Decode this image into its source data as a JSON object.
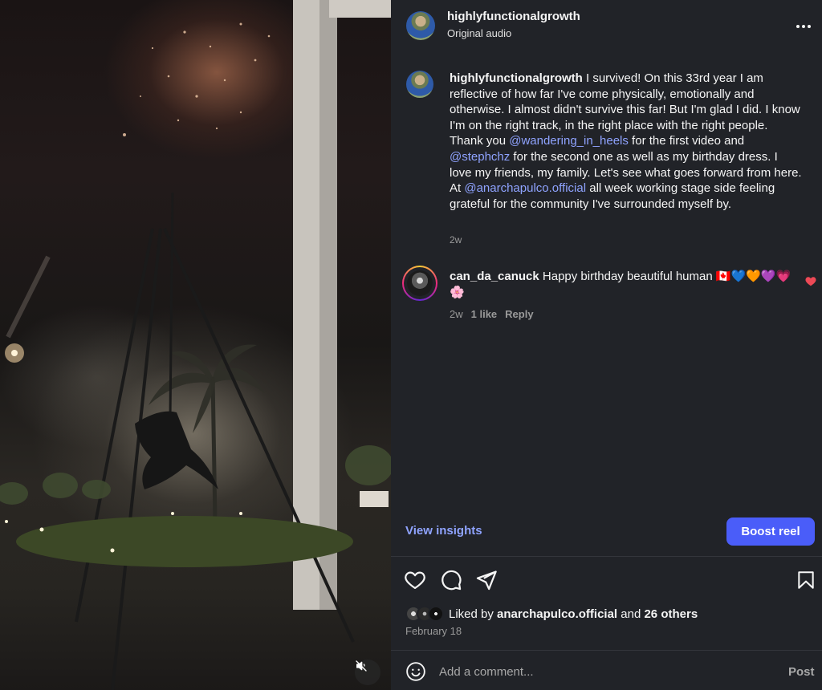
{
  "post": {
    "username": "highlyfunctionalgrowth",
    "audio": "Original audio"
  },
  "caption": {
    "username": "highlyfunctionalgrowth",
    "segments": [
      " I survived! On this 33rd year I am reflective of how far I've come physically, emotionally and otherwise. I almost didn't survive this far! But I'm glad I did. I know I'm on the right track, in the right place with the right people. Thank you ",
      "@wandering_in_heels",
      " for the first video and ",
      "@stephchz",
      " for the second one as well as my birthday dress. I love my friends, my family. Let's see what goes forward from here. At ",
      "@anarchapulco.official",
      " all week working stage side feeling grateful for the community I've surrounded myself by."
    ],
    "time": "2w"
  },
  "comment": {
    "username": "can_da_canuck",
    "text": "Happy birthday beautiful human 🇨🇦💙🧡💜💗🌸",
    "time": "2w",
    "likes": "1 like",
    "reply": "Reply"
  },
  "actions": {
    "view_insights": "View insights",
    "boost": "Boost reel"
  },
  "likes": {
    "prefix": "Liked by ",
    "user": "anarchapulco.official",
    "middle": " and ",
    "others": "26 others",
    "date": "February 18"
  },
  "comment_box": {
    "placeholder": "Add a comment...",
    "post": "Post"
  },
  "icons": {
    "more": "more-horizontal-icon",
    "mute": "volume-muted-icon",
    "like": "heart-icon",
    "comment": "comment-icon",
    "share": "send-icon",
    "save": "bookmark-icon",
    "emoji": "emoji-icon"
  },
  "colors": {
    "accent": "#4a5df9",
    "link": "#8fa3ff",
    "like_red": "#ed4956",
    "panel_bg": "#212328"
  }
}
